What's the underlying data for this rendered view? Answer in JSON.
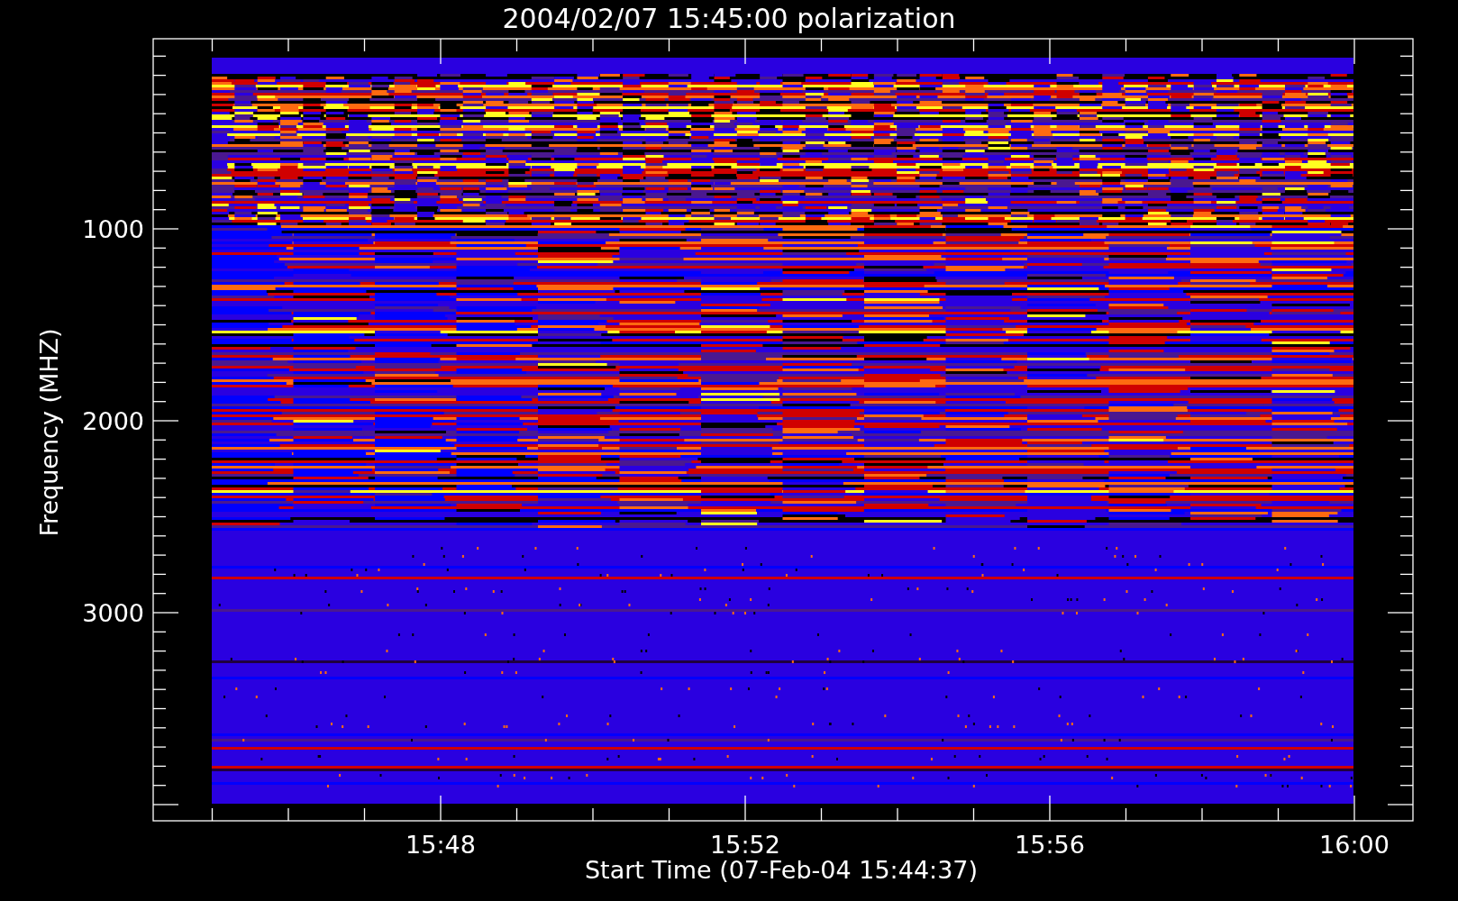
{
  "title": "2004/02/07 15:45:00 polarization",
  "y_axis": {
    "label": "Frequency (MHZ)",
    "ticks": [
      "1000",
      "2000",
      "3000"
    ]
  },
  "x_axis": {
    "label": "Start Time (07-Feb-04 15:44:37)",
    "ticks": [
      "15:48",
      "15:52",
      "15:56",
      "16:00"
    ]
  }
}
